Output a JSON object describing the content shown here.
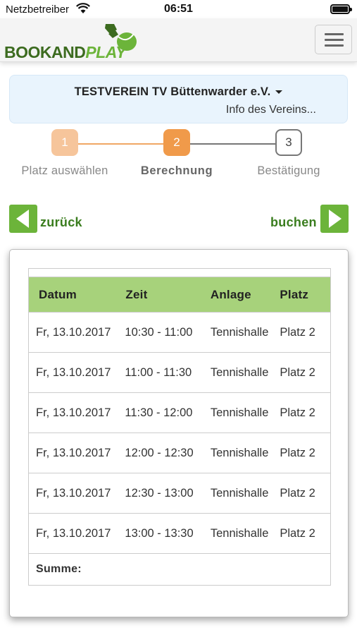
{
  "status_bar": {
    "carrier": "Netzbetreiber",
    "time": "06:51"
  },
  "header": {
    "logo": {
      "part1": "BOOK",
      "part2": "AND",
      "part3": "PLAY"
    },
    "colors": {
      "brand_dark": "#3c6b1f",
      "brand_light": "#6cb43a"
    }
  },
  "club": {
    "name": "TESTVEREIN TV Büttenwarder e.V.",
    "info_link": "Info des Vereins..."
  },
  "steps": [
    {
      "number": "1",
      "label": "Platz auswählen",
      "state": "done",
      "color": "#f6c59b"
    },
    {
      "number": "2",
      "label": "Berechnung",
      "state": "active",
      "color": "#f09a4a"
    },
    {
      "number": "3",
      "label": "Bestätigung",
      "state": "pending",
      "color": "#ffffff"
    }
  ],
  "nav": {
    "back_label": "zurück",
    "next_label": "buchen",
    "button_color": "#6cb43a"
  },
  "table": {
    "headers": [
      "Datum",
      "Zeit",
      "Anlage",
      "Platz"
    ],
    "header_color": "#a7d27b",
    "rows": [
      [
        "Fr, 13.10.2017",
        "10:30 - 11:00",
        "Tennishalle",
        "Platz 2"
      ],
      [
        "Fr, 13.10.2017",
        "11:00 - 11:30",
        "Tennishalle",
        "Platz 2"
      ],
      [
        "Fr, 13.10.2017",
        "11:30 - 12:00",
        "Tennishalle",
        "Platz 2"
      ],
      [
        "Fr, 13.10.2017",
        "12:00 - 12:30",
        "Tennishalle",
        "Platz 2"
      ],
      [
        "Fr, 13.10.2017",
        "12:30 - 13:00",
        "Tennishalle",
        "Platz 2"
      ],
      [
        "Fr, 13.10.2017",
        "13:00 - 13:30",
        "Tennishalle",
        "Platz 2"
      ]
    ],
    "sum_label": "Summe:"
  }
}
